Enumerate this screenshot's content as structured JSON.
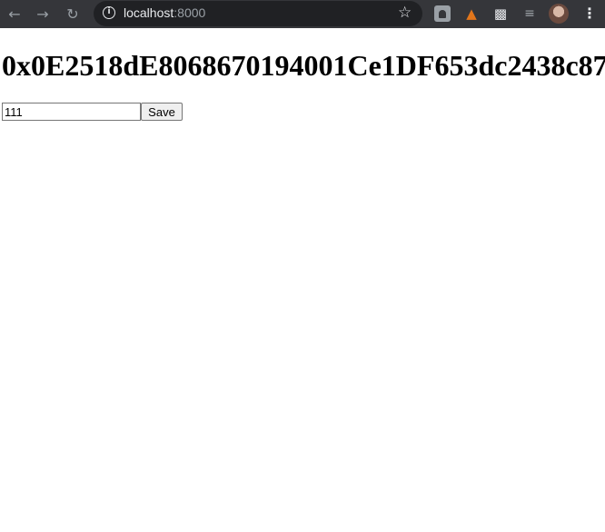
{
  "browser": {
    "url_host": "localhost",
    "url_port": ":8000",
    "icons": {
      "back": "back-arrow-icon",
      "forward": "forward-arrow-icon",
      "reload": "reload-icon",
      "info": "info-icon",
      "bookmark": "star-icon",
      "extensions": [
        "ghost-extension-icon",
        "metamask-fox-icon",
        "puzzle-extensions-icon",
        "media-control-icon"
      ],
      "profile": "avatar",
      "menu": "kebab-menu-icon"
    },
    "colors": {
      "toolbar": "#35363a",
      "omnibox": "#202124",
      "metamask": "#e2761b"
    }
  },
  "page": {
    "heading": "0x0E2518dE8068670194001Ce1DF653dc2438c87",
    "input_value": "111",
    "save_label": "Save"
  }
}
